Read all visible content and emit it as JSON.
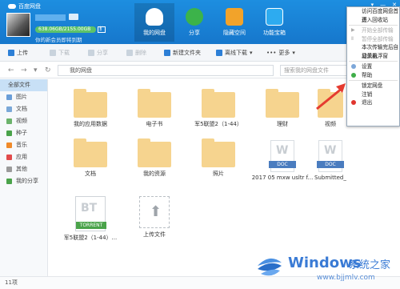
{
  "app": {
    "title": "百度网盘"
  },
  "user": {
    "quota": "638.06GB/2155.00GB",
    "expand": "扩",
    "space_hint": "你的新会员即将到期"
  },
  "nav": [
    {
      "label": "我的网盘"
    },
    {
      "label": "分享"
    },
    {
      "label": "隐藏空间"
    },
    {
      "label": "功能宝箱"
    }
  ],
  "toolbar": {
    "upload": "上传",
    "download": "下载",
    "share": "分享",
    "delete": "删除",
    "new_folder": "新建文件夹",
    "offline": "离线下载",
    "more": "更多"
  },
  "address": {
    "path": "我的网盘",
    "search_placeholder": "搜索我的网盘文件"
  },
  "sidebar": [
    {
      "label": "全部文件",
      "color": "#2d7fd6"
    },
    {
      "label": "图片",
      "color": "#6a9ed8"
    },
    {
      "label": "文档",
      "color": "#7aa8d8"
    },
    {
      "label": "视频",
      "color": "#6bb36b"
    },
    {
      "label": "种子",
      "color": "#4aa34a"
    },
    {
      "label": "音乐",
      "color": "#f08a2a"
    },
    {
      "label": "应用",
      "color": "#e14b4b"
    },
    {
      "label": "其他",
      "color": "#9b9b9b"
    },
    {
      "label": "我的分享",
      "color": "#4aa34a"
    }
  ],
  "files": [
    {
      "name": "我的应用数据"
    },
    {
      "name": "电子书"
    },
    {
      "name": "军5联盟2（1-44）"
    },
    {
      "name": "理财"
    },
    {
      "name": "视频"
    },
    {
      "name": "文档"
    },
    {
      "name": "我的资源"
    },
    {
      "name": "照片"
    },
    {
      "name": "2017 05 mxw usltr f..."
    },
    {
      "name": "Submitted_paper-l..."
    },
    {
      "name": "军5联盟2（1-44）..."
    },
    {
      "name": "上传文件"
    }
  ],
  "doc_tag": "DOC",
  "torrent_tag": "TORRENT",
  "status": {
    "count": "11项"
  },
  "menu": [
    {
      "label": "访问百度网盘首页",
      "dim": false
    },
    {
      "label": "进入回收站",
      "dim": false
    },
    {
      "label": "开始全部传输",
      "dim": true
    },
    {
      "label": "暂停全部传输",
      "dim": true
    },
    {
      "label": "本次传输完后自动关机",
      "dim": false
    },
    {
      "label": "显示悬浮窗",
      "dim": false
    },
    {
      "label": "设置",
      "dim": false,
      "icon_color": "#7da7d9"
    },
    {
      "label": "帮助",
      "dim": false,
      "icon_color": "#3fae49"
    },
    {
      "label": "锁定网盘",
      "dim": false
    },
    {
      "label": "注销",
      "dim": false
    },
    {
      "label": "退出",
      "dim": false,
      "icon_color": "#e0352e"
    }
  ],
  "watermark": {
    "title": "Windows",
    "subtitle": "系统之家",
    "url": "www.bjjmlv.com"
  }
}
